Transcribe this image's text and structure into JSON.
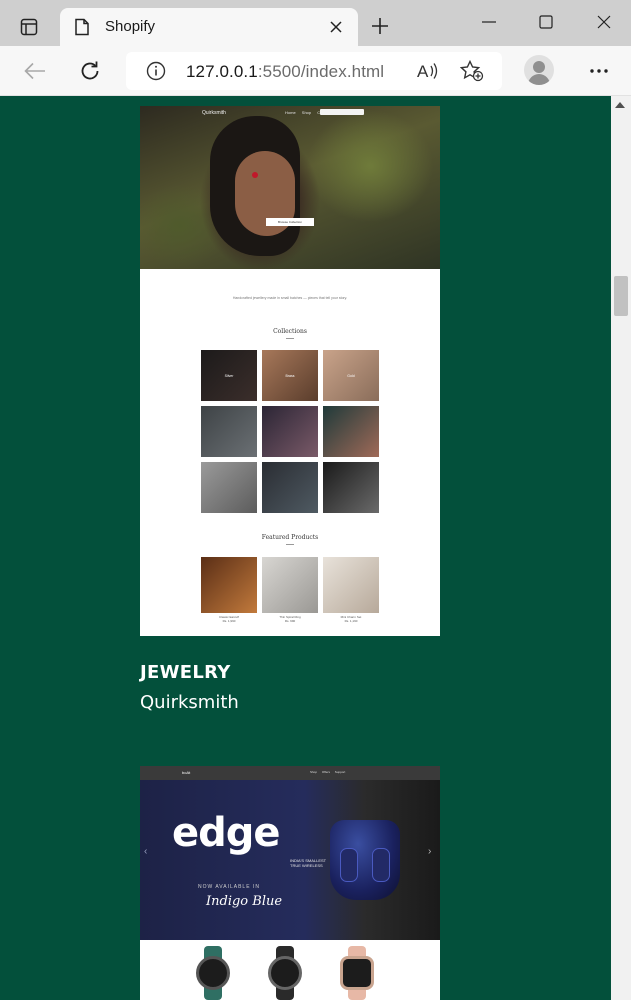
{
  "browser": {
    "tab_title": "Shopify",
    "url_main": "127.0.0.1",
    "url_rest": ":5500/index.html",
    "read_aloud_label": "A)"
  },
  "projects": [
    {
      "category": "JEWELRY",
      "name": "Quirksmith",
      "preview": {
        "brand": "Quirksmith",
        "nav_links": "Home Shop Catalog",
        "cta": "Browse Collection",
        "intro": "Handcrafted jewellery made in small batches — pieces that tell your story.",
        "collections_heading": "Collections",
        "collections": [
          "Silver",
          "Brass",
          "Gold",
          "",
          "",
          "",
          "",
          "",
          ""
        ],
        "featured_heading": "Featured Products",
        "products": [
          {
            "name": "Classic Earcuff",
            "price": "Rs. 1,990"
          },
          {
            "name": "Thin Spiral Ring",
            "price": "Rs. 990"
          },
          {
            "name": "Mini Charm Set",
            "price": "Rs. 1,190"
          }
        ]
      }
    },
    {
      "category": "",
      "name": "",
      "preview": {
        "brand": "boAt",
        "nav_links": "Shop Offers Support",
        "hero_word": "edge",
        "tagline": "INDIA'S SMALLEST TRUE WIRELESS",
        "now_available": "NOW AVAILABLE IN",
        "color_name": "Indigo Blue"
      }
    }
  ],
  "colors": {
    "page_bg": "#03503b",
    "caption_text": "#ffffff"
  }
}
